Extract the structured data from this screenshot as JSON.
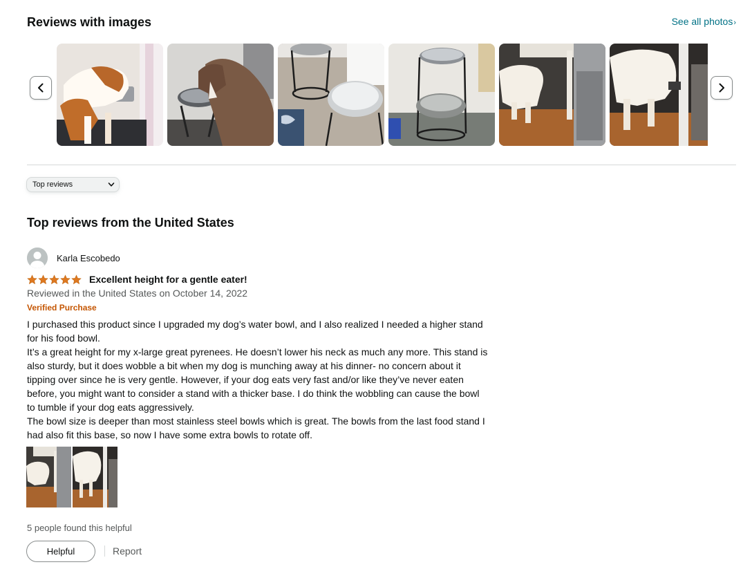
{
  "gallery": {
    "title": "Reviews with images",
    "see_all": "See all photos",
    "prev_icon": "chevron-left-icon",
    "next_icon": "chevron-right-icon",
    "thumbnails": [
      "brown-white-dog-eating-photo",
      "brindle-dog-drinking-photo",
      "two-bowl-stands-photo",
      "stand-with-two-bowls-photo",
      "white-dog-kitchen-photo",
      "white-dog-eating-photo"
    ]
  },
  "sort": {
    "selected": "Top reviews",
    "icon": "chevron-down-icon"
  },
  "reviews_heading": "Top reviews from the United States",
  "review": {
    "author": "Karla Escobedo",
    "rating": 5,
    "rating_max": 5,
    "star_color": "#de7921",
    "title": "Excellent height for a gentle eater!",
    "date": "Reviewed in the United States on October 14, 2022",
    "verified": "Verified Purchase",
    "body_lines": [
      "I purchased this product since I upgraded my dog’s water bowl, and I also realized I needed a higher stand",
      "for his food bowl.",
      "It’s a great height for my x-large great pyrenees. He doesn’t lower his neck as much any more. This stand is",
      "also sturdy, but it does wobble a bit when my dog is munching away at his dinner- no concern about it",
      "tipping over since he is very gentle. However, if your dog eats very fast and/or like they’ve never eaten",
      "before, you might want to consider a stand with a thicker base. I do think the wobbling can cause the bowl",
      "to tumble if your dog eats aggressively.",
      "The bowl size is deeper than most stainless steel bowls which is great. The bowls from the last food stand I",
      "had also fit this base, so now I have some extra bowls to rotate off."
    ],
    "images": [
      "white-dog-kitchen-photo",
      "white-dog-eating-photo"
    ],
    "helpful_count": "5 people found this helpful",
    "helpful_button": "Helpful",
    "report": "Report"
  },
  "colors": {
    "link": "#007185",
    "verified": "#c45500",
    "secondary_text": "#565959"
  }
}
